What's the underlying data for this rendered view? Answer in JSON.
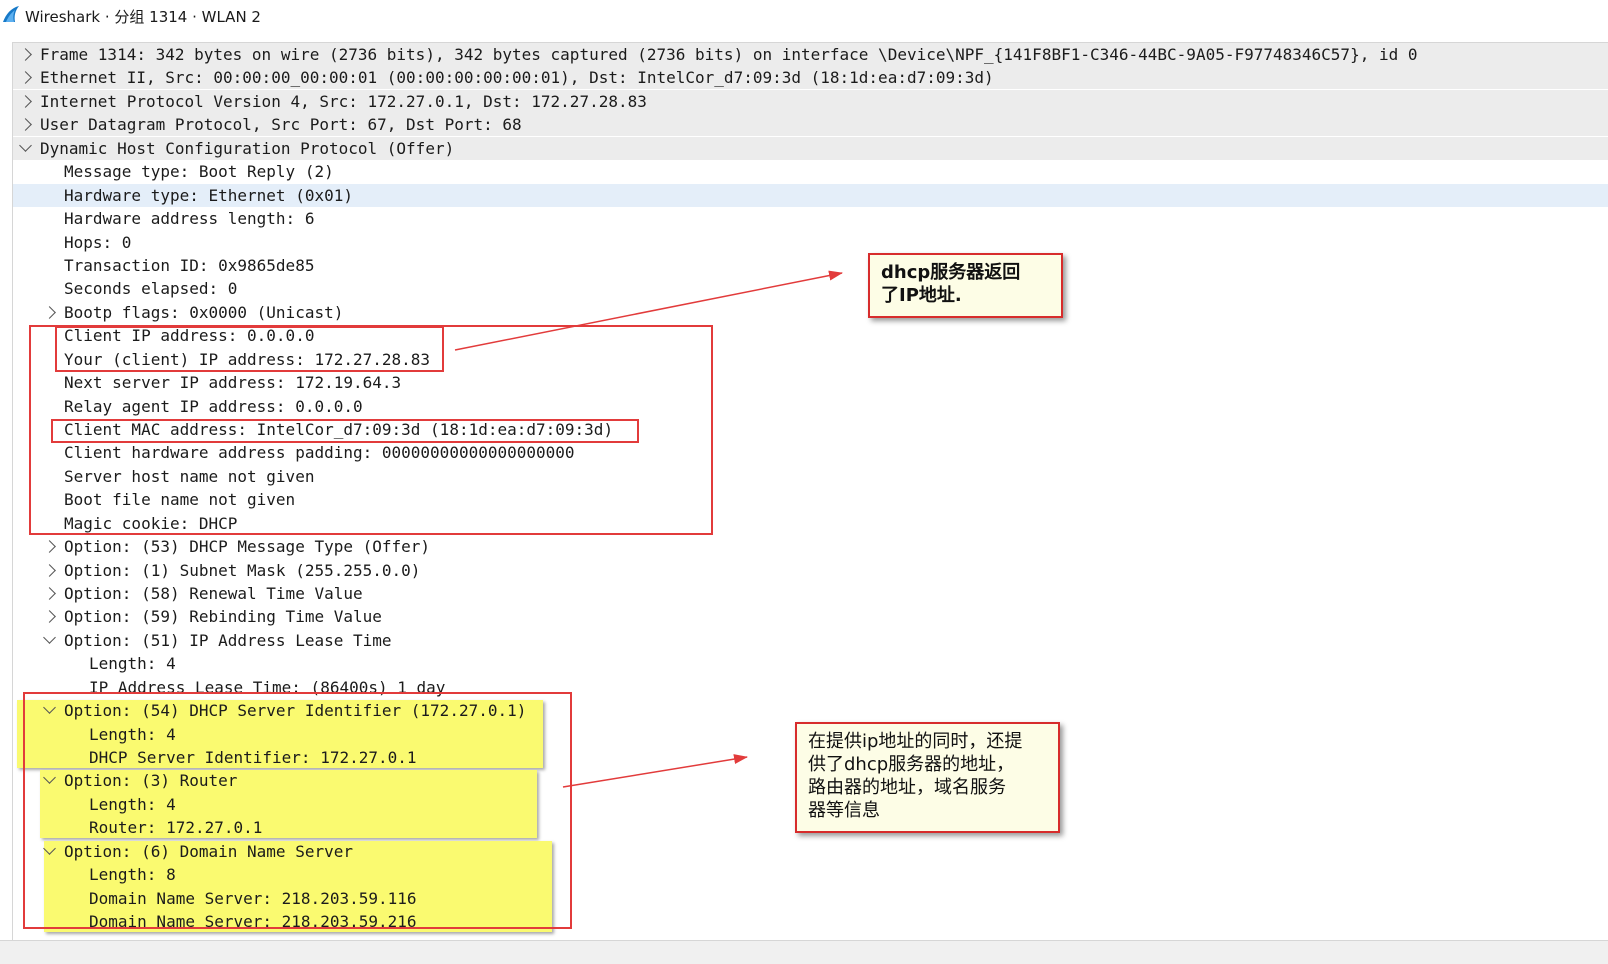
{
  "window": {
    "title": "Wireshark · 分组 1314 · WLAN 2",
    "icon": "wireshark-fin-icon"
  },
  "tree": {
    "rows": [
      {
        "text": "Frame 1314: 342 bytes on wire (2736 bits), 342 bytes captured (2736 bits) on interface \\Device\\NPF_{141F8BF1-C346-44BC-9A05-F97748346C57}, id 0",
        "level": 0,
        "state": "collapsed"
      },
      {
        "text": "Ethernet II, Src: 00:00:00_00:00:01 (00:00:00:00:00:01), Dst: IntelCor_d7:09:3d (18:1d:ea:d7:09:3d)",
        "level": 0,
        "state": "collapsed"
      },
      {
        "text": "Internet Protocol Version 4, Src: 172.27.0.1, Dst: 172.27.28.83",
        "level": 0,
        "state": "collapsed"
      },
      {
        "text": "User Datagram Protocol, Src Port: 67, Dst Port: 68",
        "level": 0,
        "state": "collapsed"
      },
      {
        "text": "Dynamic Host Configuration Protocol (Offer)",
        "level": 0,
        "state": "expanded"
      },
      {
        "text": "Message type: Boot Reply (2)",
        "level": 1,
        "state": "leaf"
      },
      {
        "text": "Hardware type: Ethernet (0x01)",
        "level": 1,
        "state": "leaf",
        "selected": true
      },
      {
        "text": "Hardware address length: 6",
        "level": 1,
        "state": "leaf"
      },
      {
        "text": "Hops: 0",
        "level": 1,
        "state": "leaf"
      },
      {
        "text": "Transaction ID: 0x9865de85",
        "level": 1,
        "state": "leaf"
      },
      {
        "text": "Seconds elapsed: 0",
        "level": 1,
        "state": "leaf"
      },
      {
        "text": "Bootp flags: 0x0000 (Unicast)",
        "level": 1,
        "state": "collapsed"
      },
      {
        "text": "Client IP address: 0.0.0.0",
        "level": 1,
        "state": "leaf"
      },
      {
        "text": "Your (client) IP address: 172.27.28.83",
        "level": 1,
        "state": "leaf"
      },
      {
        "text": "Next server IP address: 172.19.64.3",
        "level": 1,
        "state": "leaf"
      },
      {
        "text": "Relay agent IP address: 0.0.0.0",
        "level": 1,
        "state": "leaf"
      },
      {
        "text": "Client MAC address: IntelCor_d7:09:3d (18:1d:ea:d7:09:3d)",
        "level": 1,
        "state": "leaf"
      },
      {
        "text": "Client hardware address padding: 00000000000000000000",
        "level": 1,
        "state": "leaf"
      },
      {
        "text": "Server host name not given",
        "level": 1,
        "state": "leaf"
      },
      {
        "text": "Boot file name not given",
        "level": 1,
        "state": "leaf"
      },
      {
        "text": "Magic cookie: DHCP",
        "level": 1,
        "state": "leaf"
      },
      {
        "text": "Option: (53) DHCP Message Type (Offer)",
        "level": 1,
        "state": "collapsed"
      },
      {
        "text": "Option: (1) Subnet Mask (255.255.0.0)",
        "level": 1,
        "state": "collapsed"
      },
      {
        "text": "Option: (58) Renewal Time Value",
        "level": 1,
        "state": "collapsed"
      },
      {
        "text": "Option: (59) Rebinding Time Value",
        "level": 1,
        "state": "collapsed"
      },
      {
        "text": "Option: (51) IP Address Lease Time",
        "level": 1,
        "state": "expanded"
      },
      {
        "text": "Length: 4",
        "level": 2,
        "state": "leaf"
      },
      {
        "text": "IP Address Lease Time: (86400s) 1 day",
        "level": 2,
        "state": "leaf"
      },
      {
        "text": "Option: (54) DHCP Server Identifier (172.27.0.1)",
        "level": 1,
        "state": "expanded"
      },
      {
        "text": "Length: 4",
        "level": 2,
        "state": "leaf"
      },
      {
        "text": "DHCP Server Identifier: 172.27.0.1",
        "level": 2,
        "state": "leaf"
      },
      {
        "text": "Option: (3) Router",
        "level": 1,
        "state": "expanded"
      },
      {
        "text": "Length: 4",
        "level": 2,
        "state": "leaf"
      },
      {
        "text": "Router: 172.27.0.1",
        "level": 2,
        "state": "leaf"
      },
      {
        "text": "Option: (6) Domain Name Server",
        "level": 1,
        "state": "expanded"
      },
      {
        "text": "Length: 8",
        "level": 2,
        "state": "leaf"
      },
      {
        "text": "Domain Name Server: 218.203.59.116",
        "level": 2,
        "state": "leaf"
      },
      {
        "text": "Domain Name Server: 218.203.59.216",
        "level": 2,
        "state": "leaf"
      }
    ]
  },
  "annotations": {
    "note1": "dhcp服务器返回\n了IP地址.",
    "note2": "在提供ip地址的同时，还提\n供了dhcp服务器的地址，\n路由器的地址，域名服务\n器等信息"
  },
  "colors": {
    "annotation_red": "#e23b3b",
    "highlight_yellow": "#fafa70",
    "selected_row": "#e4eef9",
    "top_level_row": "#ececec",
    "note_bg": "#fdfde6"
  }
}
